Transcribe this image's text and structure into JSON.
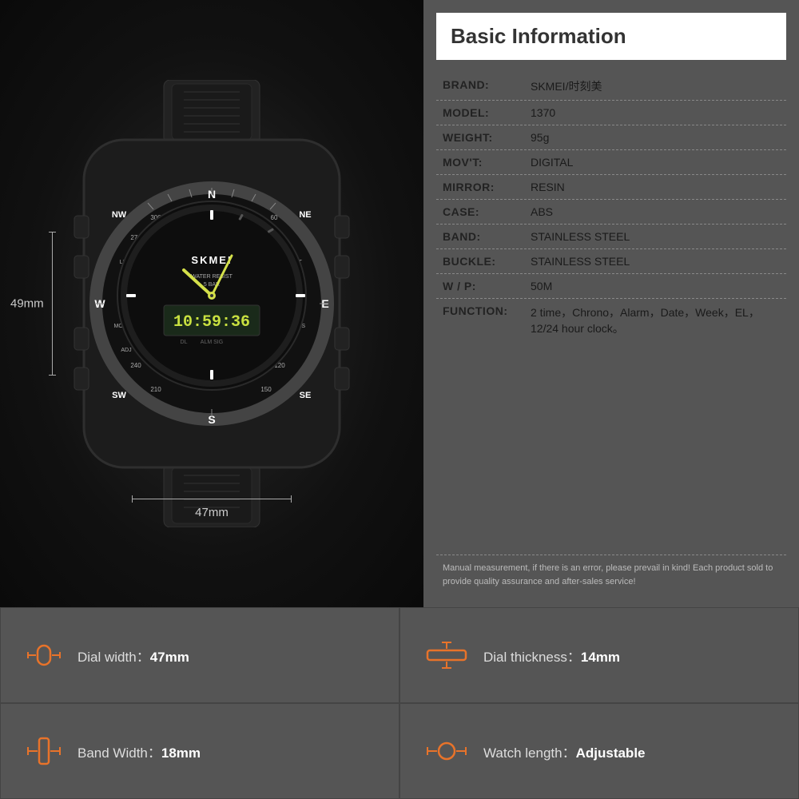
{
  "header": {
    "title": "Basic Information"
  },
  "specs": [
    {
      "label": "BRAND:",
      "value": "SKMEI/时刻美"
    },
    {
      "label": "MODEL:",
      "value": "1370"
    },
    {
      "label": "WEIGHT:",
      "value": "95g"
    },
    {
      "label": "MOV'T:",
      "value": "DIGITAL"
    },
    {
      "label": "MIRROR:",
      "value": "RESIN"
    },
    {
      "label": "CASE:",
      "value": "ABS"
    },
    {
      "label": "BAND:",
      "value": "STAINLESS STEEL"
    },
    {
      "label": "BUCKLE:",
      "value": "STAINLESS STEEL"
    },
    {
      "label": "W / P:",
      "value": "50M"
    },
    {
      "label": "FUNCTION:",
      "value": "2 time，Chrono，Alarm，Date，Week，EL，12/24 hour clock。"
    }
  ],
  "note": "Manual measurement, if there is an error, please prevail in kind!\nEach product sold to provide quality assurance and after-sales service!",
  "dimensions": {
    "height": "49mm",
    "width": "47mm"
  },
  "bottom_specs": [
    {
      "icon": "dial-width",
      "label": "Dial width：",
      "value": "47mm"
    },
    {
      "icon": "dial-thickness",
      "label": "Dial thickness：",
      "value": "14mm"
    },
    {
      "icon": "band-width",
      "label": "Band Width：",
      "value": "18mm"
    },
    {
      "icon": "watch-length",
      "label": "Watch length：",
      "value": "Adjustable"
    }
  ]
}
